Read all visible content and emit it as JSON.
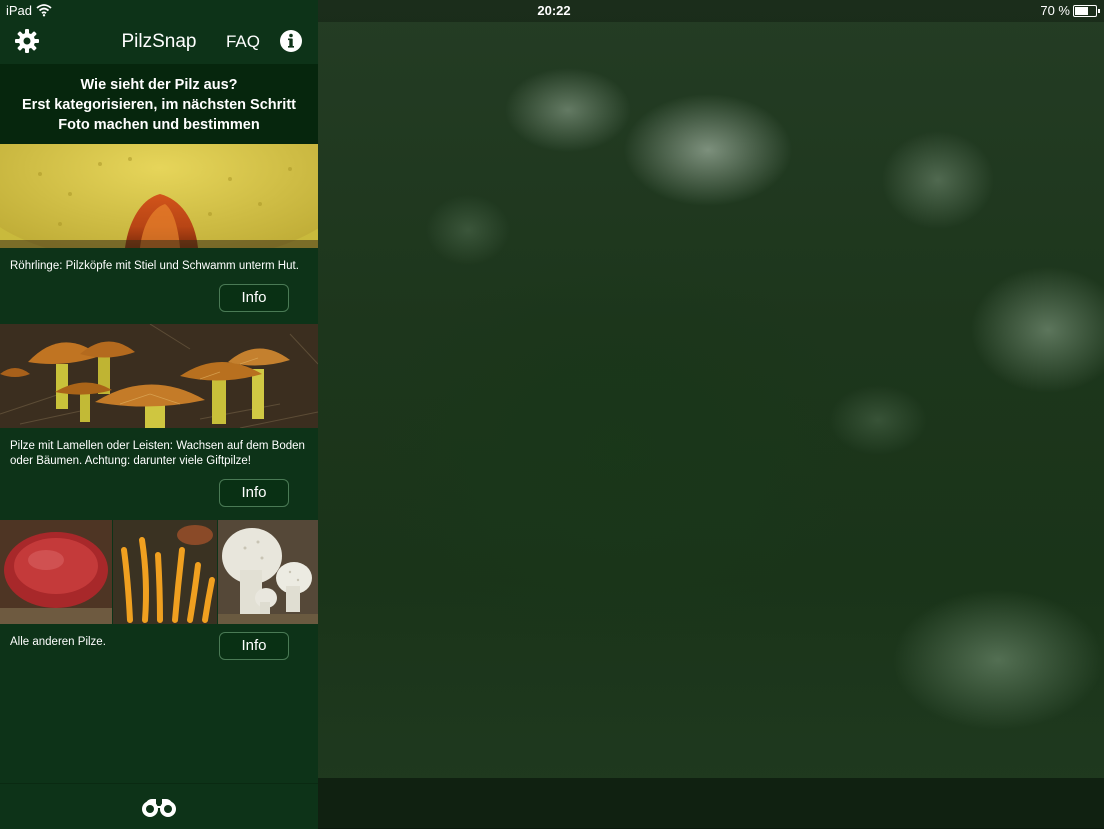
{
  "status_bar": {
    "device": "iPad",
    "time": "20:22",
    "battery_text": "70 %",
    "battery_level_percent": 70
  },
  "nav": {
    "title": "PilzSnap",
    "faq_label": "FAQ",
    "settings_icon": "gear-icon",
    "info_icon": "info-icon"
  },
  "headline": {
    "line1": "Wie sieht der Pilz aus?",
    "line2": "Erst kategorisieren, im nächsten Schritt",
    "line3": "Foto machen und bestimmen"
  },
  "categories": [
    {
      "description": "Röhrlinge: Pilzköpfe mit Stiel und Schwamm unterm Hut.",
      "button_label": "Info"
    },
    {
      "description": "Pilze mit Lamellen oder Leisten: Wachsen auf dem Boden oder Bäumen. Achtung: darunter viele Giftpilze!",
      "button_label": "Info"
    },
    {
      "description": "Alle anderen Pilze.",
      "button_label": "Info"
    }
  ],
  "bottom_bar": {
    "icon": "binoculars-icon"
  },
  "colors": {
    "panel_bg": "#0d3318",
    "headline_bg": "#06260d"
  }
}
